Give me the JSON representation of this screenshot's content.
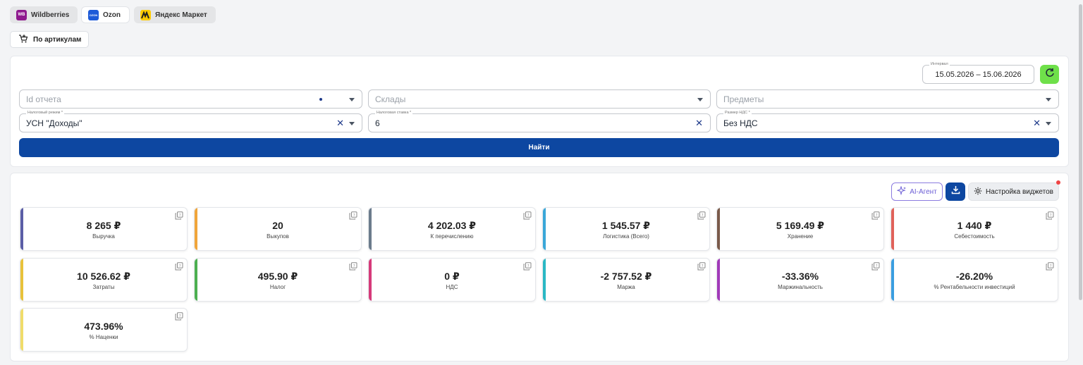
{
  "marketplaces": [
    {
      "label": "Wildberries",
      "logo_text": "WB",
      "color": "#8e1a8e",
      "active": true
    },
    {
      "label": "Ozon",
      "logo_text": "OZON",
      "color": "#1e5bd8",
      "active": false
    },
    {
      "label": "Яндекс Маркет",
      "logo_text": "",
      "color": "#ffcc00",
      "active": true
    }
  ],
  "articles_button": {
    "label": "По артикулам",
    "icon": "cart-icon"
  },
  "filters": {
    "interval": {
      "label": "Интервал",
      "value": "15.05.2026 – 15.06.2026"
    },
    "report_id": {
      "placeholder": "Id отчета"
    },
    "warehouses": {
      "placeholder": "Склады"
    },
    "subjects": {
      "placeholder": "Предметы"
    },
    "tax_regime": {
      "label": "Налоговый режим *",
      "value": "УСН \"Доходы\""
    },
    "tax_rate": {
      "label": "Налоговая ставка *",
      "value": "6"
    },
    "vat_size": {
      "label": "Размер НДС *",
      "value": "Без НДС"
    },
    "find_label": "Найти"
  },
  "toolbar": {
    "ai_label": "AI-Агент",
    "widgets_label": "Настройка виджетов"
  },
  "metrics": [
    {
      "value": "8 265 ₽",
      "label": "Выручка",
      "color": "#5b5ea6"
    },
    {
      "value": "20",
      "label": "Выкупов",
      "color": "#f0a53a"
    },
    {
      "value": "4 202.03 ₽",
      "label": "К перечислению",
      "color": "#6b7b8c"
    },
    {
      "value": "1 545.57 ₽",
      "label": "Логистика (Всего)",
      "color": "#3aa7d8"
    },
    {
      "value": "5 169.49 ₽",
      "label": "Хранение",
      "color": "#7a5a4a"
    },
    {
      "value": "1 440 ₽",
      "label": "Себестоимость",
      "color": "#e0625a"
    },
    {
      "value": "10 526.62 ₽",
      "label": "Затраты",
      "color": "#e8c23a"
    },
    {
      "value": "495.90 ₽",
      "label": "Налог",
      "color": "#4caf50"
    },
    {
      "value": "0 ₽",
      "label": "НДС",
      "color": "#d63a7a"
    },
    {
      "value": "-2 757.52 ₽",
      "label": "Маржа",
      "color": "#2ab8c4"
    },
    {
      "value": "-33.36%",
      "label": "Маржинальность",
      "color": "#a13ab8"
    },
    {
      "value": "-26.20%",
      "label": "% Рентабельности инвестиций",
      "color": "#3a9ee0"
    },
    {
      "value": "473.96%",
      "label": "% Наценки",
      "color": "#f0dc6a"
    }
  ]
}
